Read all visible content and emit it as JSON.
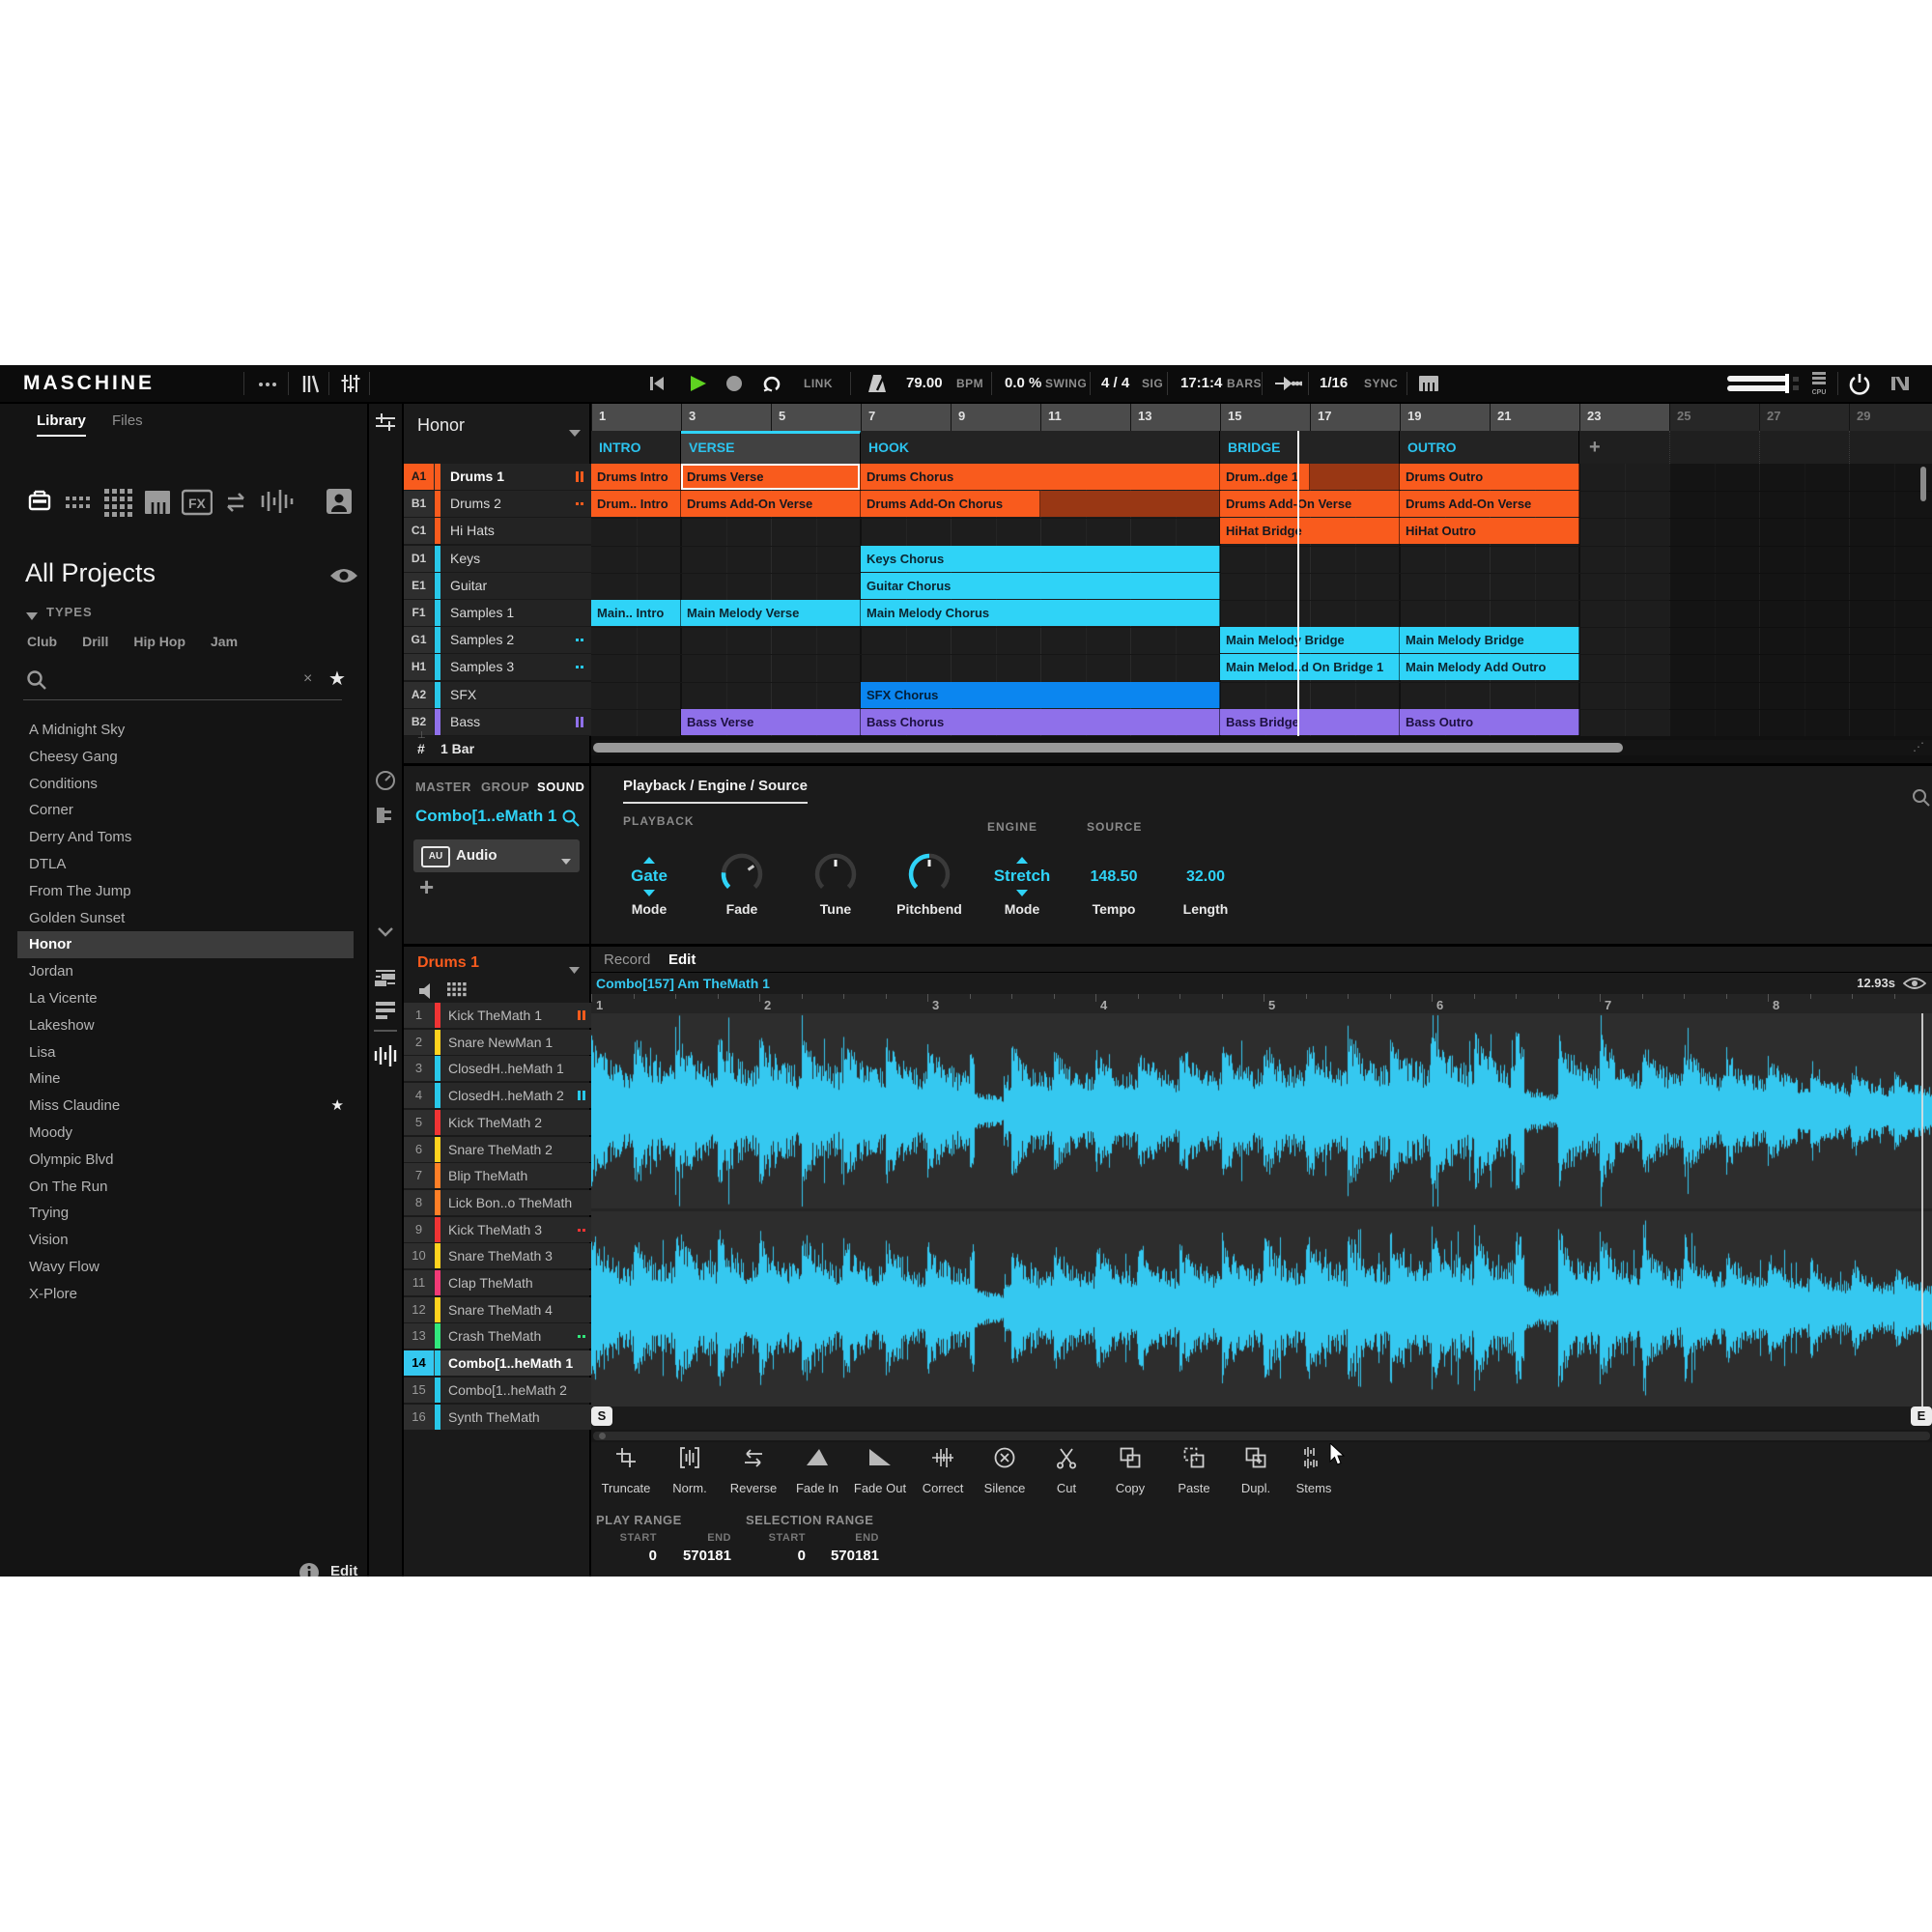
{
  "colors": {
    "accent_cyan": "#2fd3f7",
    "scene_text": "#2cc3ee",
    "orange": "#f95b1d",
    "dark_red": "#993714",
    "cyan_clip": "#2fd3f7",
    "blue_clip": "#0b86f0",
    "purple_clip": "#8f70ea",
    "play_green": "#5fd321",
    "wave": "#35c8f0",
    "pad_red": "#f03434",
    "pad_yellow": "#ffd21e",
    "pad_cyan": "#28c8ea",
    "pad_orange": "#ff7f27",
    "pad_pink": "#f23a76",
    "pad_green": "#31e87c"
  },
  "header": {
    "logo": "MASCHINE",
    "link_label": "LINK",
    "bpm": {
      "value": "79.00",
      "label": "BPM"
    },
    "swing": {
      "value": "0.0 %",
      "label": "SWING"
    },
    "sig": {
      "value": "4 / 4",
      "label": "SIG"
    },
    "bars": {
      "value": "17:1:4",
      "label": "BARS"
    },
    "step": {
      "value": "1/16"
    },
    "sync_label": "SYNC",
    "cpu_label": "CPU",
    "icons": [
      "more-options-icon",
      "browser-icon",
      "channel-strip-icon",
      "restart-icon",
      "play-icon",
      "record-icon",
      "loop-icon",
      "metronome-icon",
      "follow-icon",
      "keyboard-icon",
      "master-volume-slider",
      "cpu-meter",
      "power-icon",
      "ni-logo"
    ]
  },
  "sidebar": {
    "tabs": [
      {
        "label": "Library",
        "active": true
      },
      {
        "label": "Files",
        "active": false
      }
    ],
    "icon_names": [
      "projects-icon",
      "groups-icon",
      "sounds-icon",
      "instruments-icon",
      "effects-icon",
      "loops-icon",
      "samples-icon",
      "user-content-icon"
    ],
    "title": "All Projects",
    "types": {
      "label": "TYPES",
      "tags": [
        "Club",
        "Drill",
        "Hip Hop",
        "Jam"
      ]
    },
    "projects": [
      {
        "name": "A Midnight Sky"
      },
      {
        "name": "Cheesy Gang"
      },
      {
        "name": "Conditions"
      },
      {
        "name": "Corner"
      },
      {
        "name": "Derry And Toms"
      },
      {
        "name": "DTLA"
      },
      {
        "name": "From The Jump"
      },
      {
        "name": "Golden Sunset"
      },
      {
        "name": "Honor",
        "selected": true
      },
      {
        "name": "Jordan"
      },
      {
        "name": "La Vicente"
      },
      {
        "name": "Lakeshow"
      },
      {
        "name": "Lisa"
      },
      {
        "name": "Mine"
      },
      {
        "name": "Miss Claudine",
        "starred": true
      },
      {
        "name": "Moody"
      },
      {
        "name": "Olympic Blvd"
      },
      {
        "name": "On The Run"
      },
      {
        "name": "Trying"
      },
      {
        "name": "Vision"
      },
      {
        "name": "Wavy Flow"
      },
      {
        "name": "X-Plore"
      }
    ],
    "edit_label": "Edit"
  },
  "arranger": {
    "group_name": "Honor",
    "timeline": [
      "1",
      "3",
      "5",
      "7",
      "9",
      "11",
      "13",
      "15",
      "17",
      "19",
      "21",
      "23",
      "25",
      "27",
      "29"
    ],
    "dim_from": "25",
    "scenes": [
      {
        "name": "INTRO",
        "start": 1,
        "end": 3
      },
      {
        "name": "VERSE",
        "start": 3,
        "end": 7,
        "selected": true
      },
      {
        "name": "HOOK",
        "start": 7,
        "end": 15
      },
      {
        "name": "BRIDGE",
        "start": 15,
        "end": 19
      },
      {
        "name": "OUTRO",
        "start": 19,
        "end": 23
      }
    ],
    "add_scene_label": "+",
    "tracks": [
      {
        "badge": "A1",
        "name": "Drums 1",
        "color": "orange",
        "selected": true,
        "icon": "pause-orange"
      },
      {
        "badge": "B1",
        "name": "Drums 2",
        "color": "orange",
        "icon": "dots-orange"
      },
      {
        "badge": "C1",
        "name": "Hi Hats",
        "color": "orange"
      },
      {
        "badge": "D1",
        "name": "Keys",
        "color": "cyan"
      },
      {
        "badge": "E1",
        "name": "Guitar",
        "color": "cyan"
      },
      {
        "badge": "F1",
        "name": "Samples 1",
        "color": "cyan"
      },
      {
        "badge": "G1",
        "name": "Samples 2",
        "color": "cyan",
        "icon": "dots-cyan"
      },
      {
        "badge": "H1",
        "name": "Samples 3",
        "color": "cyan",
        "icon": "dot-cyan"
      },
      {
        "badge": "A2",
        "name": "SFX",
        "color": "cyan"
      },
      {
        "badge": "B2",
        "name": "Bass",
        "color": "purple",
        "icon": "pause-purple"
      }
    ],
    "clips": [
      {
        "track": 0,
        "start": 1,
        "end": 3,
        "label": "Drums Intro",
        "color": "orange"
      },
      {
        "track": 0,
        "start": 3,
        "end": 7,
        "label": "Drums Verse",
        "color": "orange",
        "selected": true
      },
      {
        "track": 0,
        "start": 7,
        "end": 15,
        "label": "Drums Chorus",
        "color": "orange"
      },
      {
        "track": 0,
        "start": 15,
        "end": 17,
        "label": "Drum..dge 1",
        "color": "orange"
      },
      {
        "track": 0,
        "start": 17,
        "end": 19,
        "label": "",
        "color": "darkred"
      },
      {
        "track": 0,
        "start": 19,
        "end": 23,
        "label": "Drums Outro",
        "color": "orange"
      },
      {
        "track": 1,
        "start": 1,
        "end": 3,
        "label": "Drum.. Intro",
        "color": "orange"
      },
      {
        "track": 1,
        "start": 3,
        "end": 7,
        "label": "Drums Add-On Verse",
        "color": "orange"
      },
      {
        "track": 1,
        "start": 7,
        "end": 11,
        "label": "Drums Add-On Chorus",
        "color": "orange"
      },
      {
        "track": 1,
        "start": 11,
        "end": 15,
        "label": "",
        "color": "darkred"
      },
      {
        "track": 1,
        "start": 15,
        "end": 19,
        "label": "Drums Add-On Verse",
        "color": "orange"
      },
      {
        "track": 1,
        "start": 19,
        "end": 23,
        "label": "Drums Add-On Verse",
        "color": "orange"
      },
      {
        "track": 2,
        "start": 15,
        "end": 19,
        "label": "HiHat Bridge",
        "color": "orange"
      },
      {
        "track": 2,
        "start": 19,
        "end": 23,
        "label": "HiHat Outro",
        "color": "orange"
      },
      {
        "track": 3,
        "start": 7,
        "end": 15,
        "label": "Keys Chorus",
        "color": "cyan"
      },
      {
        "track": 4,
        "start": 7,
        "end": 15,
        "label": "Guitar Chorus",
        "color": "cyan"
      },
      {
        "track": 5,
        "start": 1,
        "end": 3,
        "label": "Main.. Intro",
        "color": "cyan"
      },
      {
        "track": 5,
        "start": 3,
        "end": 7,
        "label": "Main Melody Verse",
        "color": "cyan"
      },
      {
        "track": 5,
        "start": 7,
        "end": 15,
        "label": "Main Melody Chorus",
        "color": "cyan"
      },
      {
        "track": 6,
        "start": 15,
        "end": 19,
        "label": "Main Melody Bridge",
        "color": "cyan"
      },
      {
        "track": 6,
        "start": 19,
        "end": 23,
        "label": "Main Melody Bridge",
        "color": "cyan"
      },
      {
        "track": 7,
        "start": 15,
        "end": 19,
        "label": "Main Melod..d On Bridge 1",
        "color": "cyan"
      },
      {
        "track": 7,
        "start": 19,
        "end": 23,
        "label": "Main Melody Add Outro",
        "color": "cyan"
      },
      {
        "track": 8,
        "start": 7,
        "end": 15,
        "label": "SFX Chorus",
        "color": "blue"
      },
      {
        "track": 9,
        "start": 3,
        "end": 7,
        "label": "Bass Verse",
        "color": "purple"
      },
      {
        "track": 9,
        "start": 7,
        "end": 15,
        "label": "Bass Chorus",
        "color": "purple"
      },
      {
        "track": 9,
        "start": 15,
        "end": 19,
        "label": "Bass Bridge",
        "color": "purple"
      },
      {
        "track": 9,
        "start": 19,
        "end": 23,
        "label": "Bass Outro",
        "color": "purple"
      }
    ],
    "playhead_bar": 16.72,
    "grid_hash": "#",
    "grid_label": "1 Bar"
  },
  "inspector": {
    "tabs": [
      {
        "label": "MASTER"
      },
      {
        "label": "GROUP"
      },
      {
        "label": "SOUND",
        "active": true
      }
    ],
    "sound_name": "Combo[1..eMath 1",
    "plugin_badge": "AU",
    "plugin_name": "Audio",
    "add_label": "+",
    "section_title": "Playback / Engine / Source",
    "playback_label": "PLAYBACK",
    "gate": {
      "value": "Gate",
      "label": "Mode"
    },
    "fade": {
      "label": "Fade"
    },
    "tune": {
      "label": "Tune"
    },
    "pitchbend": {
      "label": "Pitchbend"
    },
    "engine": {
      "label": "ENGINE",
      "value": "Stretch",
      "mode_label": "Mode"
    },
    "source": {
      "label": "SOURCE",
      "tempo_value": "148.50",
      "tempo_label": "Tempo",
      "length_value": "32.00",
      "length_label": "Length"
    }
  },
  "editor": {
    "group_label": "Drums 1",
    "pads": [
      {
        "num": "1",
        "name": "Kick TheMath 1",
        "color": "red",
        "icon": "pause-orange"
      },
      {
        "num": "2",
        "name": "Snare NewMan 1",
        "color": "yellow"
      },
      {
        "num": "3",
        "name": "ClosedH..heMath 1",
        "color": "cyan"
      },
      {
        "num": "4",
        "name": "ClosedH..heMath 2",
        "color": "cyan",
        "icon": "pause-cyan"
      },
      {
        "num": "5",
        "name": "Kick TheMath 2",
        "color": "red"
      },
      {
        "num": "6",
        "name": "Snare TheMath 2",
        "color": "yellow"
      },
      {
        "num": "7",
        "name": "Blip TheMath",
        "color": "orange"
      },
      {
        "num": "8",
        "name": "Lick Bon..o TheMath",
        "color": "orange"
      },
      {
        "num": "9",
        "name": "Kick TheMath 3",
        "color": "red",
        "icon": "dots-red"
      },
      {
        "num": "10",
        "name": "Snare TheMath 3",
        "color": "yellow"
      },
      {
        "num": "11",
        "name": "Clap TheMath",
        "color": "pink"
      },
      {
        "num": "12",
        "name": "Snare TheMath 4",
        "color": "yellow"
      },
      {
        "num": "13",
        "name": "Crash TheMath",
        "color": "green",
        "icon": "dots-green"
      },
      {
        "num": "14",
        "name": "Combo[1..heMath 1",
        "color": "cyan",
        "selected": true
      },
      {
        "num": "15",
        "name": "Combo[1..heMath 2",
        "color": "cyan"
      },
      {
        "num": "16",
        "name": "Synth TheMath",
        "color": "cyan"
      }
    ],
    "tabs": [
      {
        "label": "Record"
      },
      {
        "label": "Edit",
        "active": true
      }
    ],
    "sample_name": "Combo[157] Am TheMath 1",
    "duration": "12.93s",
    "ruler": [
      "1",
      "2",
      "3",
      "4",
      "5",
      "6",
      "7",
      "8"
    ],
    "start_marker": "S",
    "end_marker": "E",
    "toolbar": [
      {
        "icon": "truncate-icon",
        "label": "Truncate"
      },
      {
        "icon": "normalize-icon",
        "label": "Norm."
      },
      {
        "icon": "reverse-icon",
        "label": "Reverse"
      },
      {
        "icon": "fade-in-icon",
        "label": "Fade In"
      },
      {
        "icon": "fade-out-icon",
        "label": "Fade Out"
      },
      {
        "icon": "correct-icon",
        "label": "Correct"
      },
      {
        "icon": "silence-icon",
        "label": "Silence"
      },
      {
        "icon": "cut-icon",
        "label": "Cut"
      },
      {
        "icon": "copy-icon",
        "label": "Copy"
      },
      {
        "icon": "paste-icon",
        "label": "Paste"
      },
      {
        "icon": "duplicate-icon",
        "label": "Dupl."
      },
      {
        "icon": "stems-icon",
        "label": "Stems"
      }
    ],
    "play_range": {
      "label": "PLAY RANGE",
      "start_label": "START",
      "end_label": "END",
      "start": "0",
      "end": "570181"
    },
    "selection_range": {
      "label": "SELECTION RANGE",
      "start_label": "START",
      "end_label": "END",
      "start": "0",
      "end": "570181"
    }
  }
}
